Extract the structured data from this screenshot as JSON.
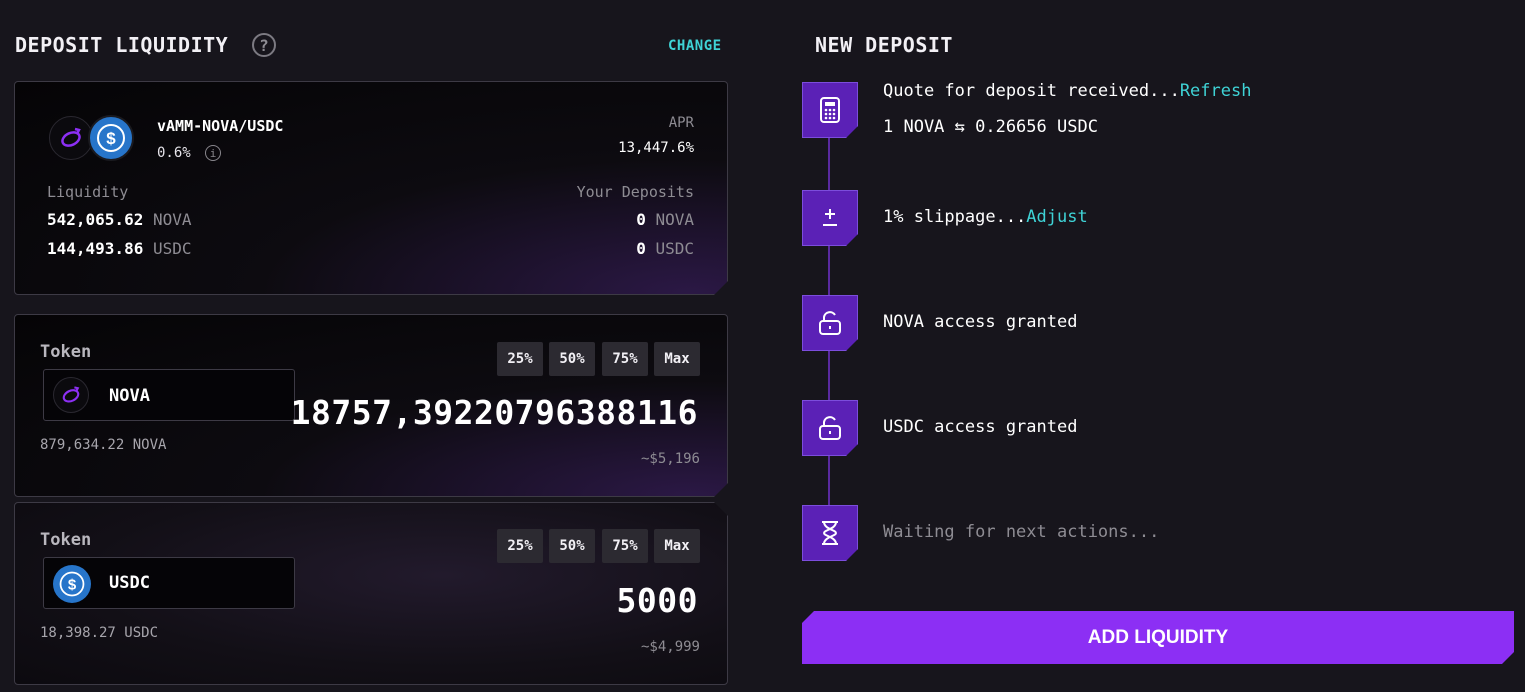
{
  "header": {
    "title": "DEPOSIT LIQUIDITY",
    "help": "?",
    "change": "CHANGE"
  },
  "pool": {
    "pair": "vAMM-NOVA/USDC",
    "fee": "0.6%",
    "info": "i",
    "apr_label": "APR",
    "apr_value": "13,447.6%",
    "liquidity_label": "Liquidity",
    "deposits_label": "Your Deposits",
    "liquidity": [
      {
        "value": "542,065.62",
        "unit": "NOVA"
      },
      {
        "value": "144,493.86",
        "unit": "USDC"
      }
    ],
    "deposits": [
      {
        "value": "0",
        "unit": "NOVA"
      },
      {
        "value": "0",
        "unit": "USDC"
      }
    ]
  },
  "token_inputs": [
    {
      "label": "Token",
      "token": "NOVA",
      "balance": "879,634.22 NOVA",
      "amount": "18757,39220796388116",
      "usd": "~$5,196",
      "pcts": [
        "25%",
        "50%",
        "75%",
        "Max"
      ]
    },
    {
      "label": "Token",
      "token": "USDC",
      "balance": "18,398.27 USDC",
      "amount": "5000",
      "usd": "~$4,999",
      "pcts": [
        "25%",
        "50%",
        "75%",
        "Max"
      ]
    }
  ],
  "new_deposit": {
    "title": "NEW DEPOSIT",
    "steps": [
      {
        "icon": "calculator-icon",
        "text": "Quote for deposit received...",
        "link": "Refresh",
        "sub": "1 NOVA ⇆ 0.26656 USDC"
      },
      {
        "icon": "plus-minus-icon",
        "text": "1% slippage...",
        "link": "Adjust"
      },
      {
        "icon": "unlock-icon",
        "text": "NOVA access granted"
      },
      {
        "icon": "unlock-icon",
        "text": "USDC access granted"
      },
      {
        "icon": "hourglass-icon",
        "text": "Waiting for next actions..."
      }
    ],
    "button": "ADD LIQUIDITY"
  },
  "colors": {
    "accent": "#8c2ff4",
    "link": "#3fd3d6",
    "step_bg": "#5b21b6",
    "usdc": "#2775ca"
  }
}
